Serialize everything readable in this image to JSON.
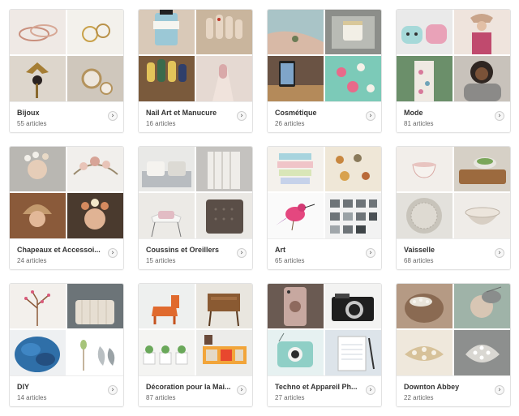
{
  "chevron_glyph": "›",
  "colors": {
    "card_border": "#e2e2e2",
    "title": "#333333",
    "count": "#666666"
  },
  "categories": [
    {
      "title": "Bijoux",
      "count": "55 articles",
      "tiles": [
        "rings-on-white",
        "gold-rings",
        "gold-pendant",
        "opal-rings"
      ]
    },
    {
      "title": "Nail Art et Manucure",
      "count": "16 articles",
      "tiles": [
        "blue-polish-bottle",
        "heart-nails",
        "patterned-nails",
        "pink-nails"
      ]
    },
    {
      "title": "Cosmétique",
      "count": "26 articles",
      "tiles": [
        "arm-tattoo",
        "cream-jar",
        "phone-dock",
        "floral-nails"
      ]
    },
    {
      "title": "Mode",
      "count": "81 articles",
      "tiles": [
        "mint-bags",
        "woman-pink-top",
        "floral-dress",
        "woman-grey-scarf"
      ]
    },
    {
      "title": "Chapeaux et Accessoi...",
      "count": "24 articles",
      "tiles": [
        "flower-crown",
        "floral-headband",
        "knit-hat",
        "flower-crown-portrait"
      ]
    },
    {
      "title": "Coussins et Oreillers",
      "count": "15 articles",
      "tiles": [
        "sofa-cushions",
        "knit-blanket",
        "white-chair",
        "brown-pillow"
      ]
    },
    {
      "title": "Art",
      "count": "65 articles",
      "tiles": [
        "stacked-bowls",
        "animal-prints",
        "pink-bird",
        "photo-grid"
      ]
    },
    {
      "title": "Vaisselle",
      "count": "68 articles",
      "tiles": [
        "teacup",
        "wood-board",
        "silver-plate",
        "ceramic-bowl"
      ]
    },
    {
      "title": "DIY",
      "count": "14 articles",
      "tiles": [
        "twig-tree",
        "knit-throw",
        "blue-yarn",
        "leaf-cutouts"
      ]
    },
    {
      "title": "Décoration pour la Mai...",
      "count": "87 articles",
      "tiles": [
        "orange-horse",
        "wood-side-table",
        "planters-wall",
        "orange-sideboard"
      ]
    },
    {
      "title": "Techno et Appareil Ph...",
      "count": "27 articles",
      "tiles": [
        "phone-case",
        "vintage-camera",
        "instant-camera",
        "notepad"
      ]
    },
    {
      "title": "Downton Abbey",
      "count": "22 articles",
      "tiles": [
        "hair-comb",
        "grey-fascinator",
        "pearl-brooch",
        "silver-brooch"
      ]
    }
  ]
}
